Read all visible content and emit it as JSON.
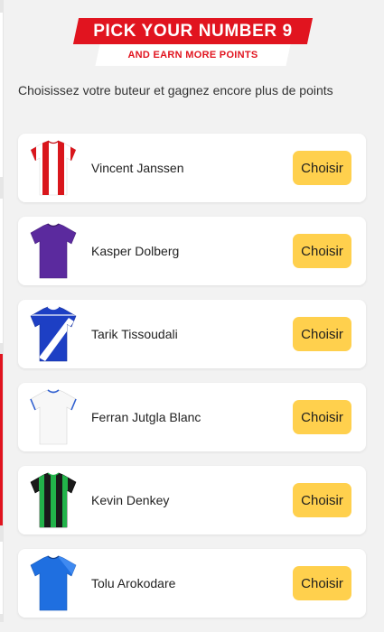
{
  "header": {
    "title": "PICK YOUR NUMBER 9",
    "subtitle": "AND EARN MORE POINTS",
    "accent_color": "#e1141f"
  },
  "intro_text": "Choisissez votre buteur et gagnez encore plus de points",
  "choose_label": "Choisir",
  "button_color": "#ffd04d",
  "players": [
    {
      "name": "Vincent Janssen",
      "jersey": "red-white-stripes-icon"
    },
    {
      "name": "Kasper Dolberg",
      "jersey": "purple-shirt-icon"
    },
    {
      "name": "Tarik Tissoudali",
      "jersey": "blue-white-sash-icon"
    },
    {
      "name": "Ferran Jutgla Blanc",
      "jersey": "white-blue-trim-icon"
    },
    {
      "name": "Kevin Denkey",
      "jersey": "green-black-stripes-icon"
    },
    {
      "name": "Tolu Arokodare",
      "jersey": "blue-shirt-icon"
    }
  ]
}
